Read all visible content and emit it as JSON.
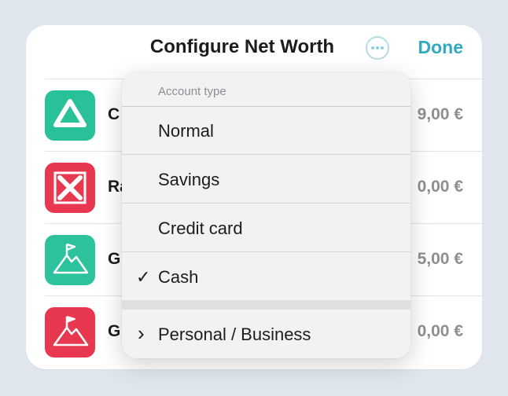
{
  "header": {
    "title": "Configure Net Worth",
    "more_icon": "ellipsis-circle-icon",
    "done_label": "Done"
  },
  "accounts": [
    {
      "name": "C",
      "amount": "9,00 €",
      "icon": "bank-diamond-icon",
      "color": "#28c19a"
    },
    {
      "name": "Ra",
      "amount": "0,00 €",
      "icon": "bank-cross-logo-icon",
      "color": "#e8384f"
    },
    {
      "name": "G",
      "amount": "5,00 €",
      "icon": "mountain-flag-icon",
      "color": "#2cc29e"
    },
    {
      "name": "G",
      "amount": "0,00 €",
      "icon": "mountain-flag-icon",
      "color": "#e8384f"
    }
  ],
  "menu": {
    "header": "Account type",
    "items": [
      {
        "label": "Normal",
        "mark": ""
      },
      {
        "label": "Savings",
        "mark": ""
      },
      {
        "label": "Credit card",
        "mark": ""
      },
      {
        "label": "Cash",
        "mark": "✓"
      }
    ],
    "submenu": {
      "label": "Personal / Business",
      "mark": "›",
      "icon": "chevron-right-icon"
    }
  },
  "colors": {
    "accent": "#31a9c0",
    "background": "#dfe6ee"
  }
}
